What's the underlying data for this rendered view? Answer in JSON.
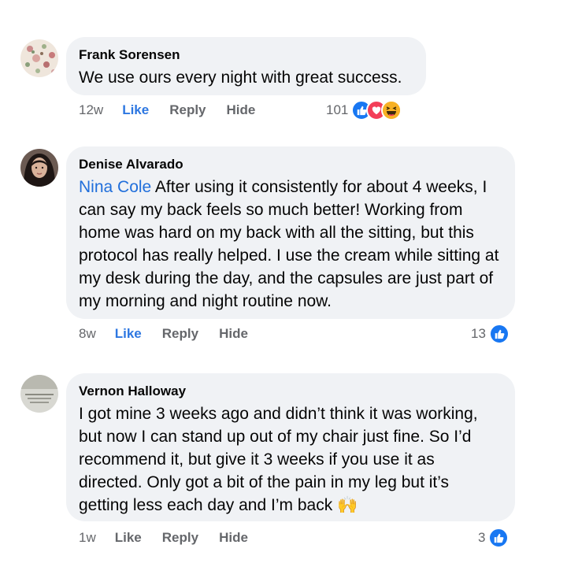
{
  "comments": [
    {
      "author": "Frank Sorensen",
      "mention": "",
      "text": "We use ours every night with great success.",
      "time": "12w",
      "like_label": "Like",
      "reply_label": "Reply",
      "hide_label": "Hide",
      "reaction_count": "101",
      "reactions": [
        "like-icon",
        "love-icon",
        "haha-icon"
      ],
      "liked": true
    },
    {
      "author": "Denise Alvarado",
      "mention": "Nina Cole",
      "text": "After using it consistently for about 4 weeks, I can say my back feels so much better! Working from home was hard on my back with all the sitting, but this protocol has really helped. I use the cream while sitting at my desk during the day, and the capsules are just part of my morning and night routine now.",
      "time": "8w",
      "like_label": "Like",
      "reply_label": "Reply",
      "hide_label": "Hide",
      "reaction_count": "13",
      "reactions": [
        "like-icon"
      ],
      "liked": true
    },
    {
      "author": "Vernon Halloway",
      "mention": "",
      "text": "I got mine 3 weeks ago and didn’t think it was working, but now I can stand up out of my chair just fine. So I’d recommend it, but give it 3 weeks if you use it as directed. Only got a bit of the pain in my leg but it’s getting less each day and I’m back 🙌",
      "time": "1w",
      "like_label": "Like",
      "reply_label": "Reply",
      "hide_label": "Hide",
      "reaction_count": "3",
      "reactions": [
        "like-icon"
      ],
      "liked": false
    }
  ],
  "colors": {
    "bubble": "#f0f2f5",
    "link": "#216fdb",
    "like_active": "#2d77e1",
    "meta": "#65676b"
  }
}
